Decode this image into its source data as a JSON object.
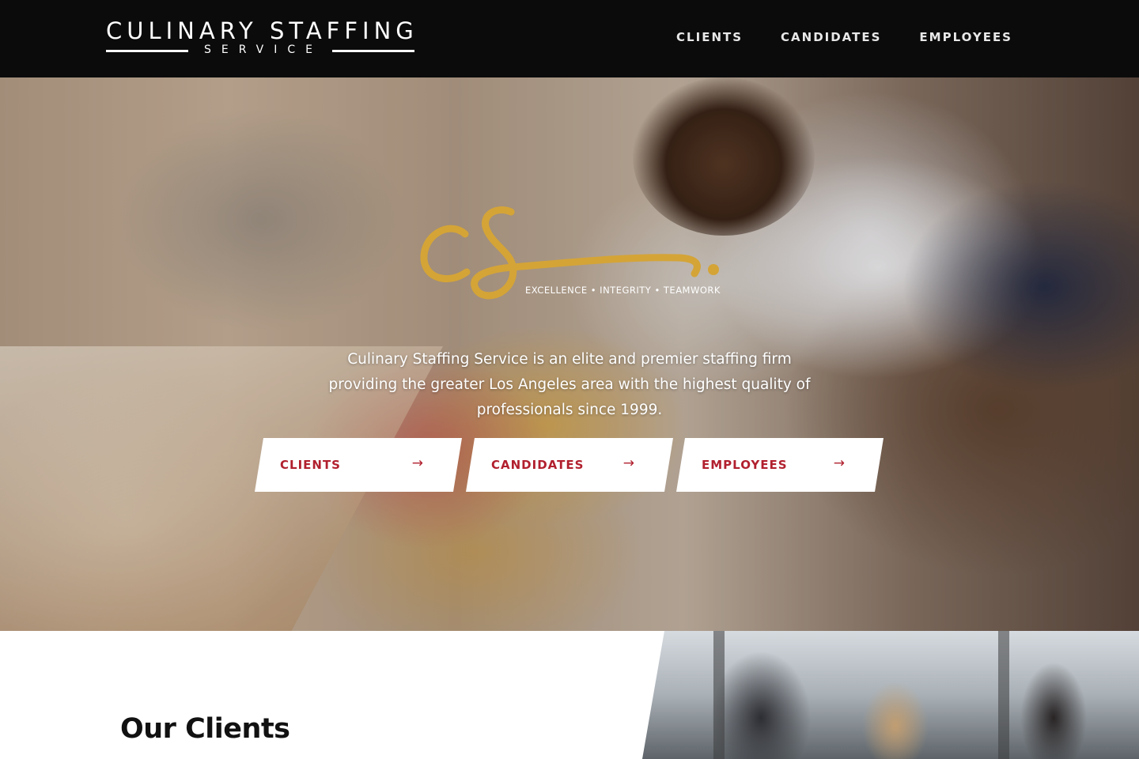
{
  "header": {
    "logo": {
      "title": "CULINARY STAFFING",
      "subtitle": "SERVICE"
    },
    "nav": [
      {
        "label": "CLIENTS"
      },
      {
        "label": "CANDIDATES"
      },
      {
        "label": "EMPLOYEES"
      }
    ]
  },
  "hero": {
    "brand_mark": {
      "monogram": "CS",
      "color": "#d4a437"
    },
    "tagline": "EXCELLENCE • INTEGRITY • TEAMWORK",
    "intro": "Culinary Staffing Service is an elite and premier staffing firm providing the greater Los Angeles area with the highest quality of professionals since 1999.",
    "ctas": [
      {
        "label": "CLIENTS",
        "icon": "arrow-right-icon"
      },
      {
        "label": "CANDIDATES",
        "icon": "arrow-right-icon"
      },
      {
        "label": "EMPLOYEES",
        "icon": "arrow-right-icon"
      }
    ]
  },
  "clients_section": {
    "title": "Our Clients"
  },
  "colors": {
    "header_bg": "#0b0b0b",
    "accent_red": "#b1202e",
    "gold": "#d4a437",
    "white": "#ffffff"
  }
}
